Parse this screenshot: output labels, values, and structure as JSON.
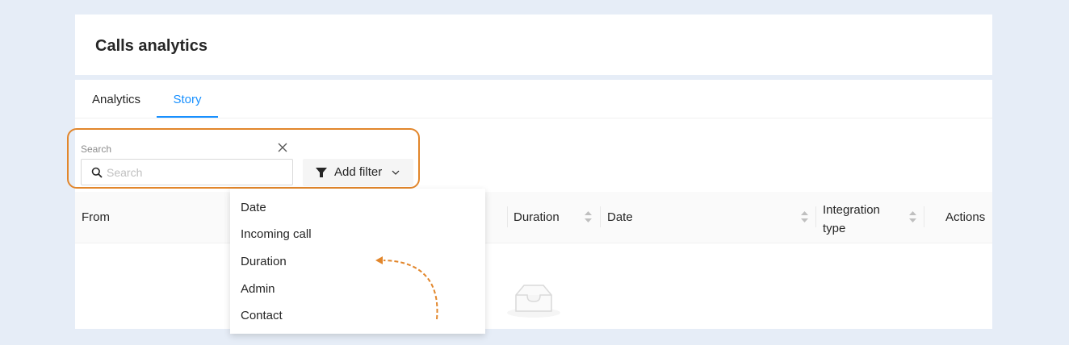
{
  "header": {
    "title": "Calls analytics"
  },
  "tabs": [
    {
      "label": "Analytics",
      "active": false
    },
    {
      "label": "Story",
      "active": true
    }
  ],
  "search": {
    "label": "Search",
    "placeholder": "Search",
    "value": ""
  },
  "filter_button": {
    "label": "Add filter"
  },
  "table": {
    "columns": [
      {
        "label": "From",
        "sortable": false
      },
      {
        "label": "Duration",
        "sortable": true
      },
      {
        "label": "Date",
        "sortable": true
      },
      {
        "label": "Integration",
        "label_line2": "type",
        "sortable": true
      },
      {
        "label": "Actions",
        "sortable": false
      }
    ],
    "rows": [],
    "empty_icon": "inbox-icon"
  },
  "filter_dropdown": {
    "options": [
      "Date",
      "Incoming call",
      "Duration",
      "Admin",
      "Contact"
    ]
  },
  "colors": {
    "accent": "#1890ff",
    "highlight": "#e2862b",
    "background": "#e6edf7"
  }
}
